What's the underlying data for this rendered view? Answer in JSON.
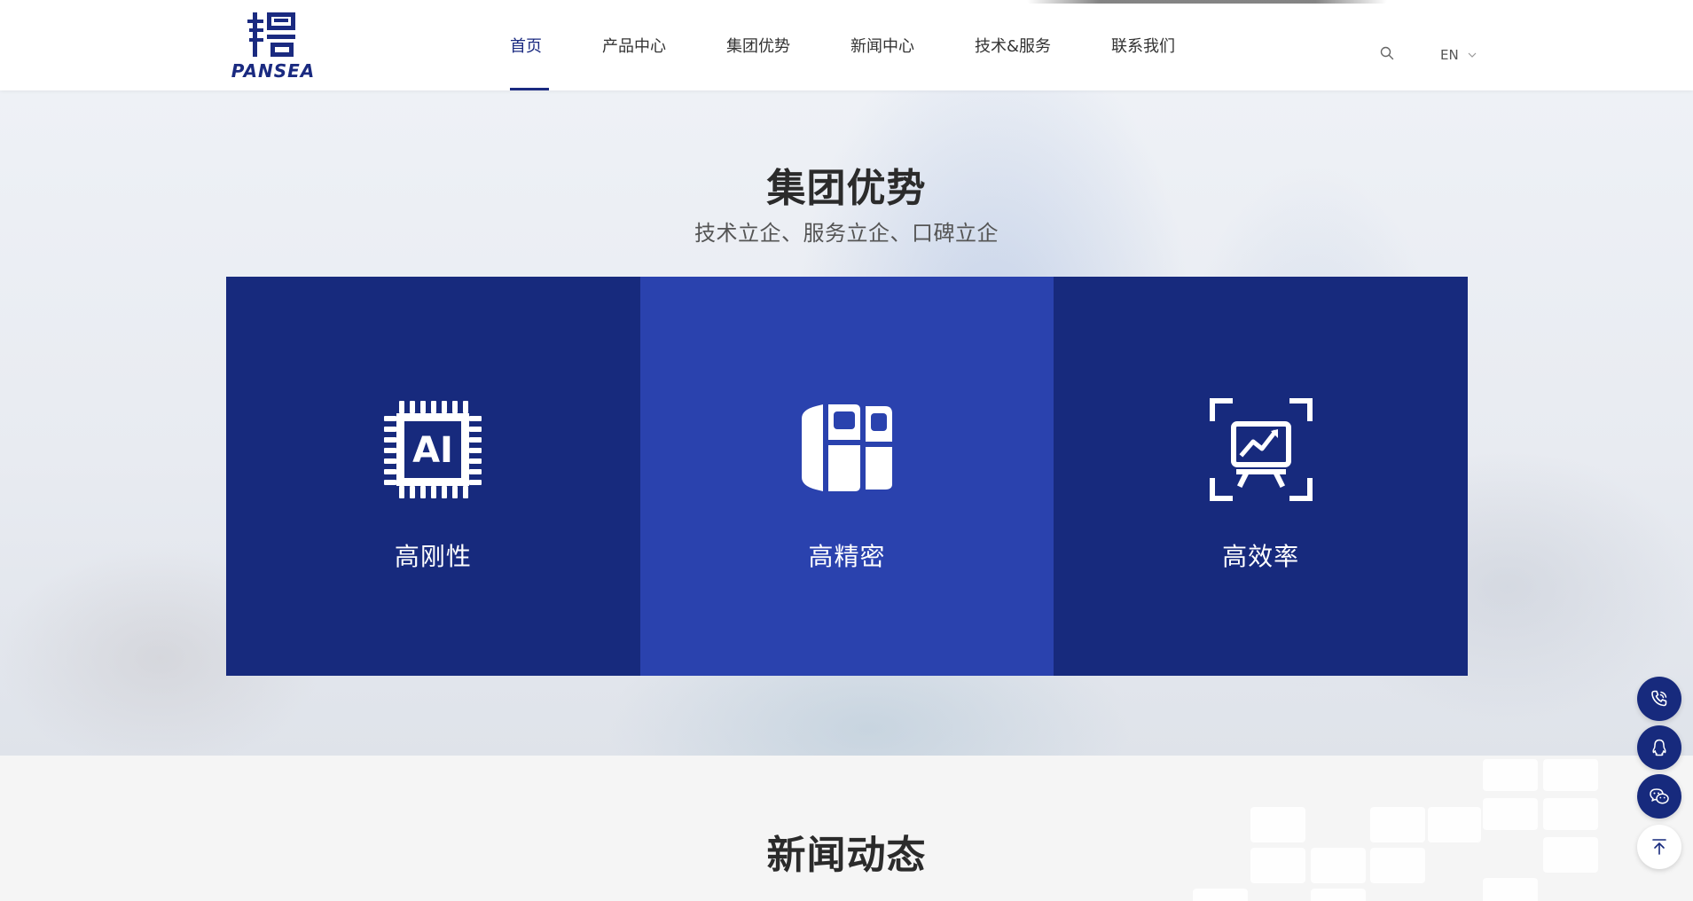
{
  "brand": {
    "name": "PANSEA",
    "primary_color": "#172a7d",
    "highlight_color": "#2a42ae"
  },
  "nav": {
    "items": [
      {
        "label": "首页",
        "active": true
      },
      {
        "label": "产品中心",
        "active": false
      },
      {
        "label": "集团优势",
        "active": false
      },
      {
        "label": "新闻中心",
        "active": false
      },
      {
        "label": "技术&服务",
        "active": false
      },
      {
        "label": "联系我们",
        "active": false
      }
    ],
    "search_icon": "search-icon",
    "language": "EN",
    "language_icon": "chevron-down-icon"
  },
  "advantage": {
    "title": "集团优势",
    "subtitle": "技术立企、服务立企、口碑立企",
    "cards": [
      {
        "label": "高刚性",
        "icon": "ai-chip-icon",
        "highlighted": false
      },
      {
        "label": "高精密",
        "icon": "precision-blocks-icon",
        "highlighted": true
      },
      {
        "label": "高效率",
        "icon": "presentation-chart-icon",
        "highlighted": false
      }
    ]
  },
  "news": {
    "title": "新闻动态"
  },
  "floating": [
    {
      "icon": "phone-icon"
    },
    {
      "icon": "qq-icon"
    },
    {
      "icon": "wechat-icon"
    },
    {
      "icon": "back-to-top-icon"
    }
  ]
}
